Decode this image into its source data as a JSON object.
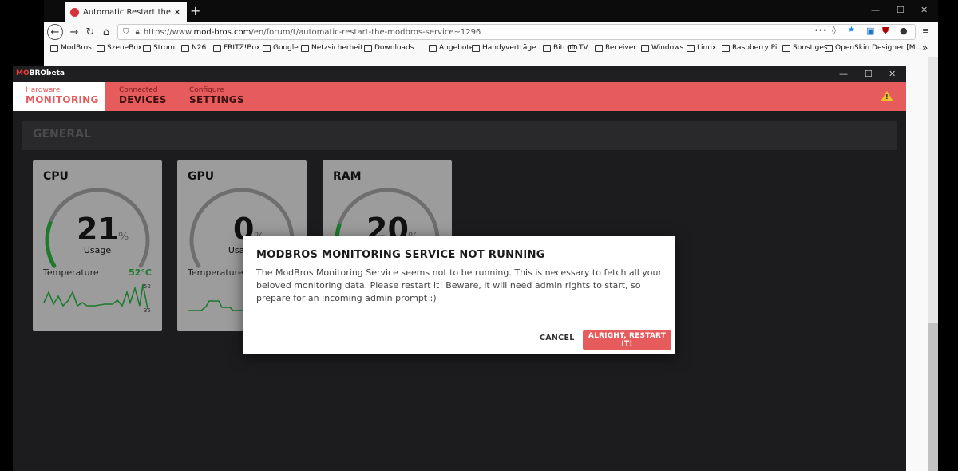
{
  "browser": {
    "tab_title": "Automatic Restart the ModBros",
    "tab_close": "✕",
    "new_tab": "+",
    "url_prefix": "https://www.",
    "url_host": "mod-bros.com",
    "url_path": "/en/forum/t/automatic-restart-the-modbros-service~1296",
    "url_more": "•••",
    "bookmarks": [
      "ModBros",
      "SzeneBox",
      "Strom",
      "N26",
      "FRITZ!Box",
      "Google",
      "Netzsicherheit",
      "Downloads",
      "Angebote",
      "Handyverträge",
      "Bitcoin",
      "TV",
      "Receiver",
      "Windows",
      "Linux",
      "Raspberry Pi",
      "Sonstiges",
      "OpenSkin Designer [M..."
    ],
    "bookmarks_overflow": "»"
  },
  "app": {
    "logo_red": "MO",
    "logo_white": "BRObeta",
    "nav": [
      {
        "small": "Hardware",
        "big": "MONITORING"
      },
      {
        "small": "Connected",
        "big": "DEVICES"
      },
      {
        "small": "Configure",
        "big": "SETTINGS"
      }
    ],
    "warning_glyph": "!",
    "section_title": "GENERAL",
    "cards": [
      {
        "title": "CPU",
        "value": "21",
        "unit": "%",
        "sub": "Usage",
        "temp_label": "Temperature",
        "temp_value": "52°C",
        "tick_high": "52",
        "tick_low": "35",
        "usage_fraction": 0.21
      },
      {
        "title": "GPU",
        "value": "0",
        "unit": "%",
        "sub": "Usage",
        "temp_label": "Temperature",
        "temp_value": "",
        "tick_high": "",
        "tick_low": "",
        "usage_fraction": 0.0
      },
      {
        "title": "RAM",
        "value": "20",
        "unit": "%",
        "sub": "",
        "temp_label": "",
        "temp_value": "",
        "tick_high": "",
        "tick_low": "",
        "usage_fraction": 0.2
      }
    ]
  },
  "dialog": {
    "title": "MODBROS MONITORING SERVICE NOT RUNNING",
    "body": "The ModBros Monitoring Service seems not to be running. This is necessary to fetch all your beloved monitoring data. Please restart it! Beware, it will need admin rights to start, so prepare for an incoming admin prompt :)",
    "cancel_label": "CANCEL",
    "confirm_label": "ALRIGHT, RESTART IT!"
  },
  "colors": {
    "accent": "#e65b5b",
    "gauge_green": "#1d7a2d",
    "gauge_track": "#6e6e6e"
  }
}
